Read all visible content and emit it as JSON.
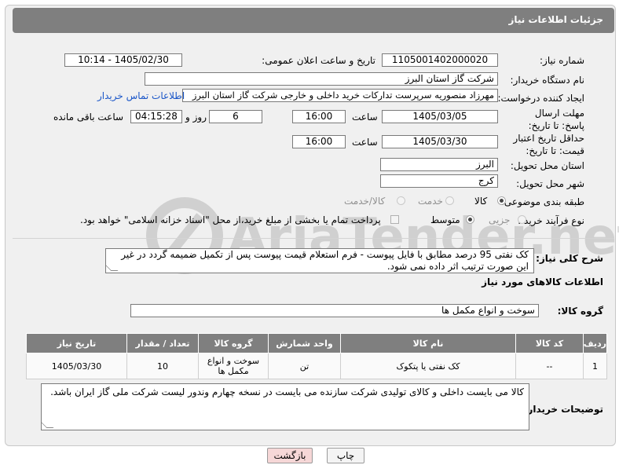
{
  "header": {
    "title": "جزئیات اطلاعات نیاز"
  },
  "labels": {
    "need_number": "شماره نیاز:",
    "announce_datetime": "تاریخ و ساعت اعلان عمومی:",
    "buyer_org": "نام دستگاه خریدار:",
    "requester": "ایجاد کننده درخواست:",
    "reply_deadline": "مهلت ارسال پاسخ: تا تاریخ:",
    "time": "ساعت",
    "day_and": "روز و",
    "time_left": "ساعت باقی مانده",
    "min_price_validity": "حداقل تاریخ اعتبار قیمت: تا تاریخ:",
    "delivery_province": "استان محل تحویل:",
    "delivery_city": "شهر محل تحویل:",
    "subject_category": "طبقه بندی موضوعی:",
    "purchase_process": "نوع فرآیند خرید :",
    "general_description": "شرح کلی نیاز:",
    "goods_info": "اطلاعات کالاهای مورد نیاز",
    "goods_group": "گروه کالا:",
    "buyer_notes": "توضیحات خریدار:"
  },
  "fields": {
    "need_number": "1105001402000020",
    "announce_datetime": "1405/02/30 - 10:14",
    "buyer_org": "شرکت گاز استان البرز",
    "requester": "مهرزاد منصوریه سرپرست تدارکات خرید داخلی و خارجی شرکت گاز استان البرز",
    "contact_link": "اطلاعات تماس خریدار",
    "reply_date": "1405/03/05",
    "reply_time": "16:00",
    "days_left": "6",
    "time_left": "04:15:28",
    "price_date": "1405/03/30",
    "price_time": "16:00",
    "province": "البرز",
    "city": "کرج"
  },
  "category_options": [
    "کالا",
    "خدمت",
    "کالا/خدمت"
  ],
  "category_selected": "کالا",
  "process_options": [
    "جزیی",
    "متوسط"
  ],
  "process_selected": "متوسط",
  "treasury_note": "پرداخت تمام یا بخشی از مبلغ خرید،از محل \"اسناد خزانه اسلامی\" خواهد بود.",
  "general_description": "کک نفتی 95 درصد مطابق با فایل پیوست - فرم استعلام قیمت پیوست پس از تکمیل ضمیمه گردد در غیر این صورت ترتیب اثر داده نمی شود.",
  "goods_group_value": "سوخت و انواع مکمل ها",
  "table": {
    "headers": [
      "ردیف",
      "کد کالا",
      "نام کالا",
      "واحد شمارش",
      "گروه کالا",
      "تعداد / مقدار",
      "تاریخ نیاز"
    ],
    "rows": [
      [
        "1",
        "--",
        "کک نفتی یا پتکوک",
        "تن",
        "سوخت و انواع مکمل ها",
        "10",
        "1405/03/30"
      ]
    ]
  },
  "buyer_notes": "کالا می بایست داخلی و کالای تولیدی شرکت سازنده می بایست در نسخه چهارم وندور لیست شرکت ملی گاز ایران باشد.",
  "buttons": {
    "print": "چاپ",
    "back": "بازگشت"
  },
  "watermark_text": "AriaTender.net",
  "colors": {
    "header_bg": "#7f7f7f",
    "link": "#1a56c8",
    "back_button_bg": "#f6d7d7"
  }
}
